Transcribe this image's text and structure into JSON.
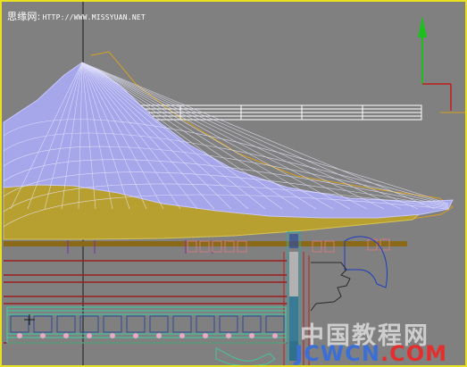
{
  "watermark": {
    "cn": "思缘网:",
    "url": "HTTP://WWW.MISSYUAN.NET"
  },
  "logo": {
    "cn": "中国教程网",
    "latin_part1": "JCWCN",
    "latin_part2": ".COM"
  },
  "icons": {
    "axis_gizmo": "y-axis-arrow-icon",
    "pivot": "pivot-icon"
  },
  "colors": {
    "viewport_bg": "#808080",
    "active_border": "#e8e020",
    "roof_mesh": "#a6a6ea",
    "roof_base": "#b8a030",
    "wood_beams": "#9c1d1d",
    "rail": "#46c39c",
    "axis_y": "#1cc01c",
    "axis_x": "#c01c1c"
  }
}
